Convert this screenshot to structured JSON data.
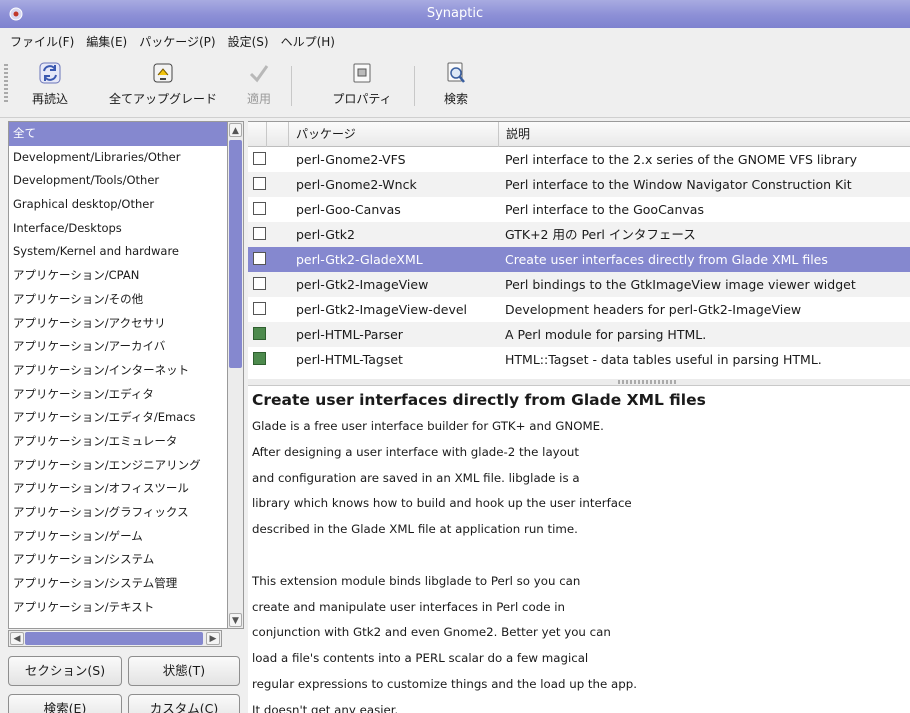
{
  "window": {
    "title": "Synaptic"
  },
  "menu": [
    "ファイル(F)",
    "編集(E)",
    "パッケージ(P)",
    "設定(S)",
    "ヘルプ(H)"
  ],
  "toolbar": {
    "reload": "再読込",
    "upgrade_all": "全てアップグレード",
    "apply": "適用",
    "properties": "プロパティ",
    "search": "検索"
  },
  "sections": [
    "全て",
    "Development/Libraries/Other",
    "Development/Tools/Other",
    "Graphical desktop/Other",
    "Interface/Desktops",
    "System/Kernel and hardware",
    "アプリケーション/CPAN",
    "アプリケーション/その他",
    "アプリケーション/アクセサリ",
    "アプリケーション/アーカイバ",
    "アプリケーション/インターネット",
    "アプリケーション/エディタ",
    "アプリケーション/エディタ/Emacs",
    "アプリケーション/エミュレータ",
    "アプリケーション/エンジニアリング",
    "アプリケーション/オフィスツール",
    "アプリケーション/グラフィックス",
    "アプリケーション/ゲーム",
    "アプリケーション/システム",
    "アプリケーション/システム管理",
    "アプリケーション/テキスト"
  ],
  "filter_buttons": {
    "sections": "セクション(S)",
    "status": "状態(T)",
    "search": "検索(E)",
    "custom": "カスタム(C)"
  },
  "table": {
    "col_package": "パッケージ",
    "col_description": "説明",
    "rows": [
      {
        "name": "perl-Gnome2-VFS",
        "desc": "Perl interface to the 2.x series of the GNOME VFS library",
        "installed": false
      },
      {
        "name": "perl-Gnome2-Wnck",
        "desc": "Perl interface to the Window Navigator Construction Kit",
        "installed": false
      },
      {
        "name": "perl-Goo-Canvas",
        "desc": "Perl interface to the GooCanvas",
        "installed": false
      },
      {
        "name": "perl-Gtk2",
        "desc": "GTK+2 用の Perl インタフェース",
        "installed": false
      },
      {
        "name": "perl-Gtk2-GladeXML",
        "desc": "Create user interfaces directly from Glade XML files",
        "installed": false
      },
      {
        "name": "perl-Gtk2-ImageView",
        "desc": "Perl bindings to the GtkImageView image viewer widget",
        "installed": false
      },
      {
        "name": "perl-Gtk2-ImageView-devel",
        "desc": "Development headers for perl-Gtk2-ImageView",
        "installed": false
      },
      {
        "name": "perl-HTML-Parser",
        "desc": "A Perl module for parsing HTML.",
        "installed": true
      },
      {
        "name": "perl-HTML-Tagset",
        "desc": "HTML::Tagset - data tables useful in parsing HTML.",
        "installed": true
      }
    ]
  },
  "details": {
    "title": "Create user interfaces directly from Glade XML files",
    "lines": [
      "Glade is a free user interface builder for GTK+ and GNOME.",
      "After designing a user interface with glade-2 the layout",
      "and configuration are saved in an XML file. libglade is a",
      "library which knows how to build and hook up the user interface",
      "described in the Glade XML file at application run time.",
      "",
      "This extension module binds libglade to Perl so you can",
      "create and manipulate user interfaces in Perl code in",
      "conjunction with Gtk2 and even Gnome2. Better yet you can",
      "load a file's contents into a PERL scalar do a few magical",
      "regular expressions to customize things and the load up the app.",
      "It doesn't get any easier."
    ]
  },
  "colors": {
    "accent": "#8588cf",
    "installed": "#4d8a4d"
  }
}
